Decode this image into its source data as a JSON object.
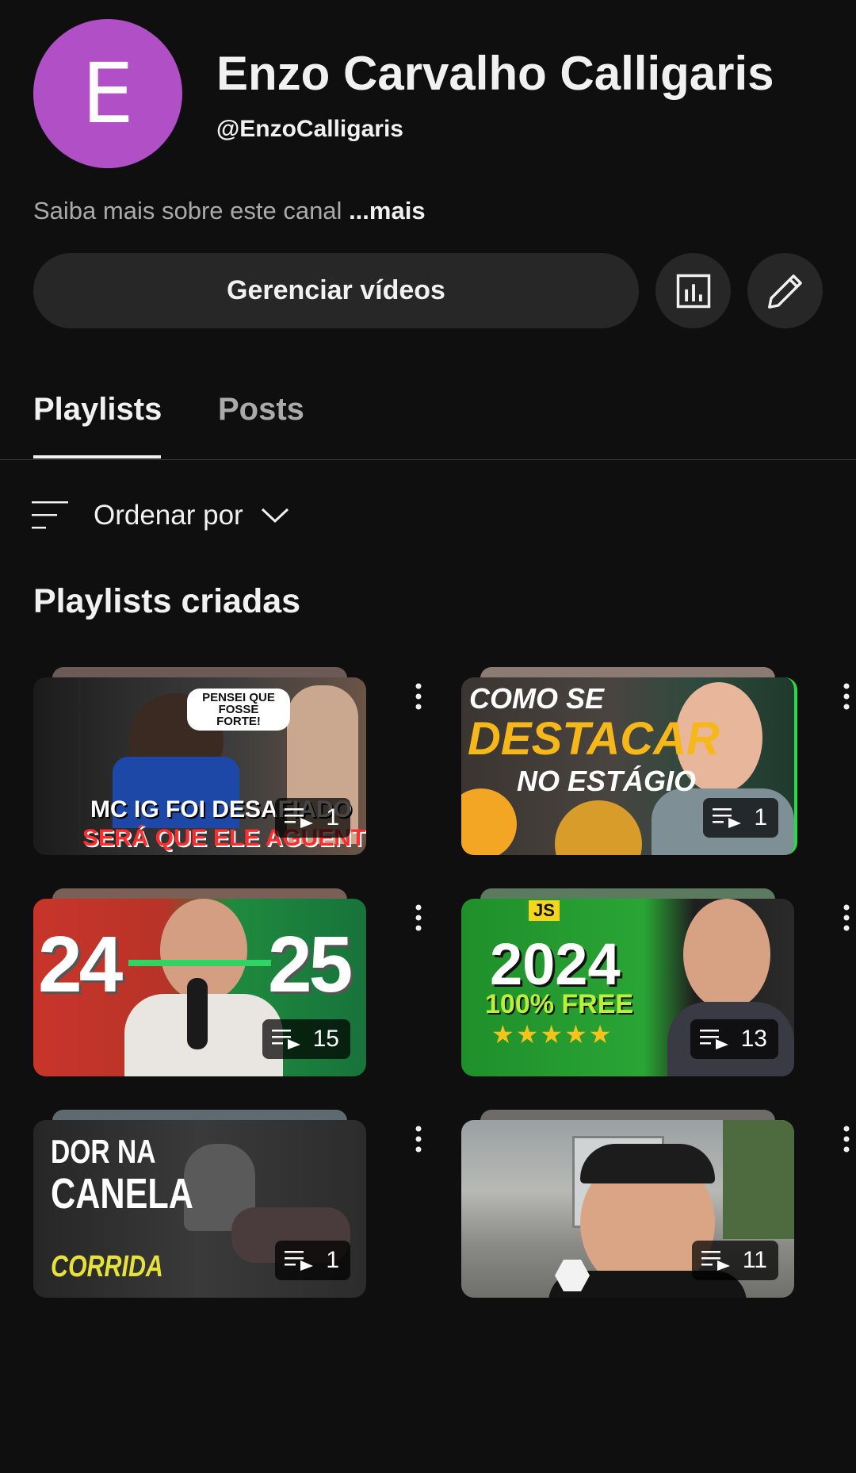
{
  "channel": {
    "avatar_letter": "E",
    "name": "Enzo Carvalho Calligaris",
    "handle": "@EnzoCalligaris",
    "about_text": "Saiba mais sobre este canal ",
    "about_more": "...mais"
  },
  "actions": {
    "manage_videos": "Gerenciar vídeos",
    "stats_icon": "bar-chart-icon",
    "edit_icon": "pencil-icon"
  },
  "tabs": [
    {
      "label": "Playlists",
      "active": true
    },
    {
      "label": "Posts",
      "active": false
    }
  ],
  "sort": {
    "label": "Ordenar por"
  },
  "section_title": "Playlists criadas",
  "playlists": [
    {
      "count": "1",
      "thumb_text_1": "PENSEI QUE FOSSE FORTE!",
      "thumb_text_2": "MC IG FOI DESAFIADO",
      "thumb_text_3": "SERÁ QUE ELE AGUENTOU?"
    },
    {
      "count": "1",
      "thumb_text_1": "COMO SE",
      "thumb_text_2": "DESTACAR",
      "thumb_text_3": "NO ESTÁGIO"
    },
    {
      "count": "15",
      "thumb_text_1": "24",
      "thumb_text_2": "25"
    },
    {
      "count": "13",
      "thumb_text_1": "2024",
      "thumb_text_2": "100% FREE",
      "thumb_text_3": "JS"
    },
    {
      "count": "1",
      "thumb_text_1": "DOR NA",
      "thumb_text_2": "CANELA",
      "thumb_text_3": "CORRIDA"
    },
    {
      "count": "11"
    }
  ],
  "colors": {
    "background": "#0f0f0f",
    "avatar": "#b04fc6",
    "button_bg": "#272727",
    "text_primary": "#f1f1f1",
    "text_secondary": "#aaaaaa"
  }
}
